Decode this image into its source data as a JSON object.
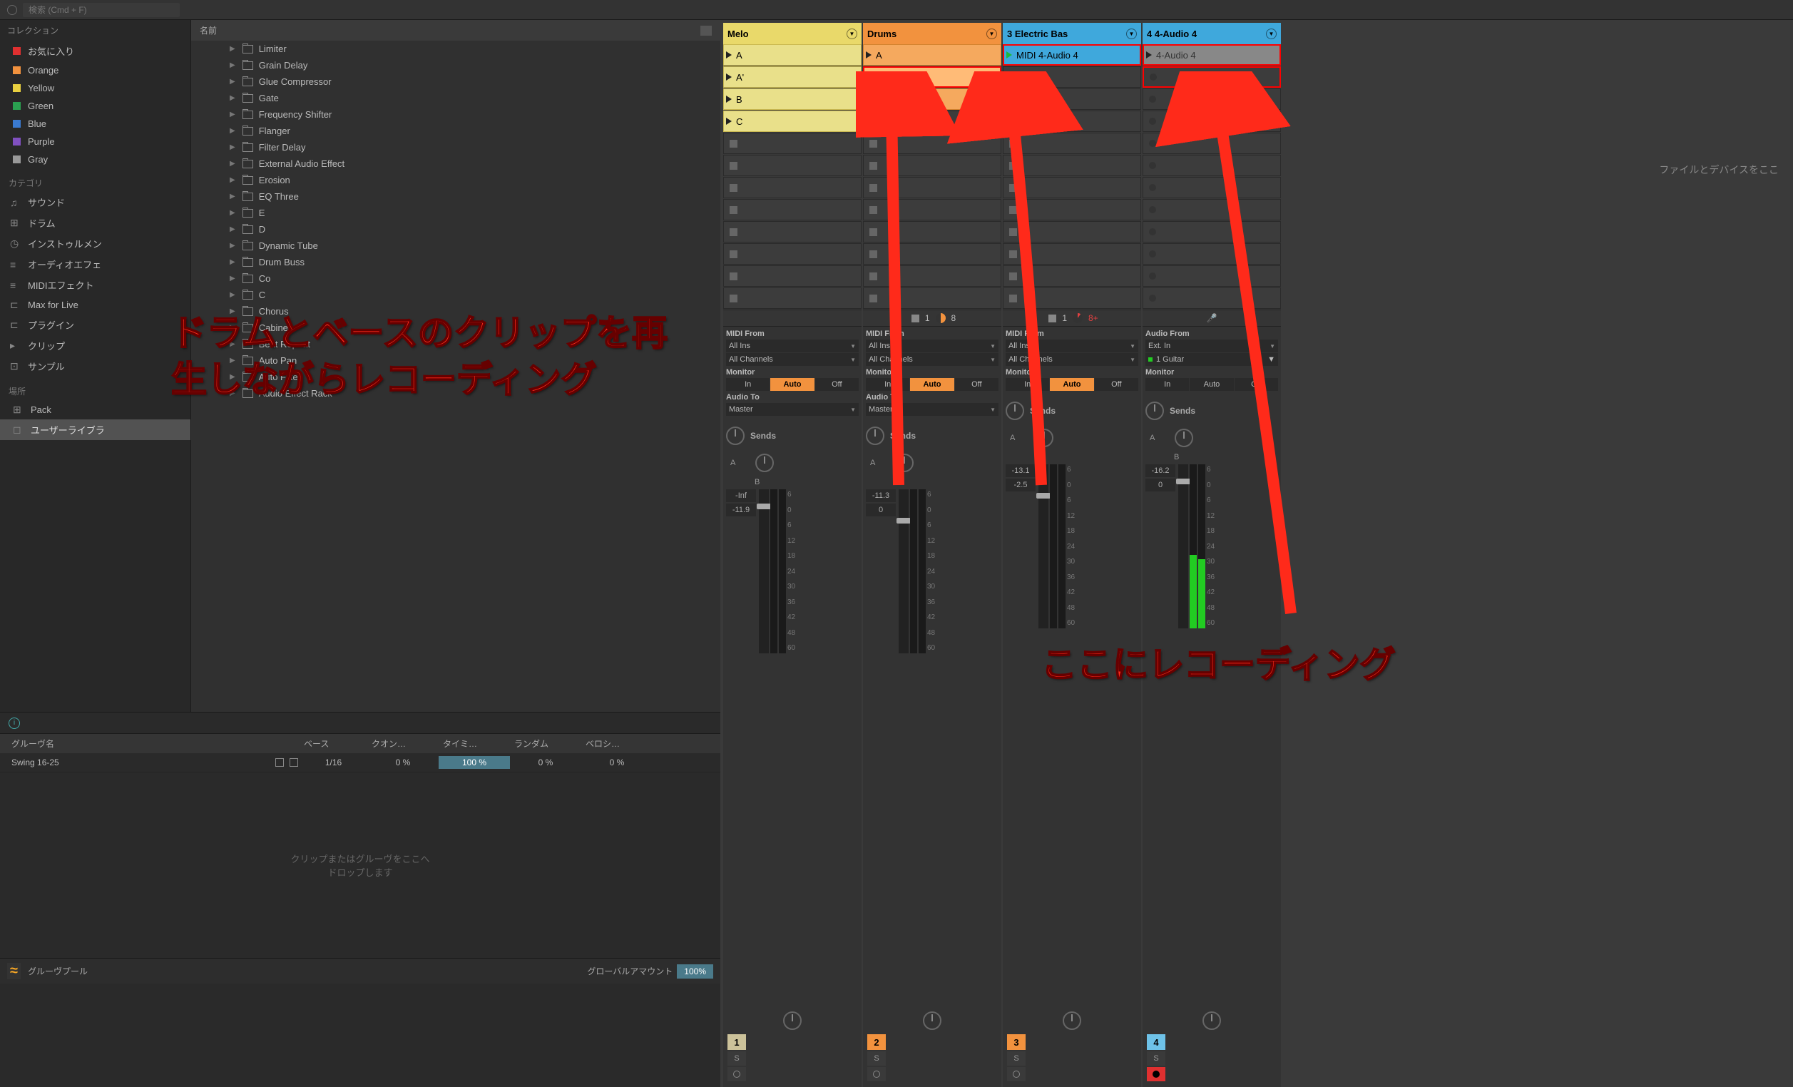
{
  "search": {
    "placeholder": "検索 (Cmd + F)"
  },
  "collections": {
    "header": "コレクション",
    "items": [
      {
        "label": "お気に入り",
        "color": "#e03030"
      },
      {
        "label": "Orange",
        "color": "#f2923e"
      },
      {
        "label": "Yellow",
        "color": "#e9d040"
      },
      {
        "label": "Green",
        "color": "#2aa050"
      },
      {
        "label": "Blue",
        "color": "#3a7ad0"
      },
      {
        "label": "Purple",
        "color": "#8050c0"
      },
      {
        "label": "Gray",
        "color": "#999"
      }
    ]
  },
  "categories": {
    "header": "カテゴリ",
    "items": [
      "サウンド",
      "ドラム",
      "インストゥルメン",
      "オーディオエフェ",
      "MIDIエフェクト",
      "Max for Live",
      "プラグイン",
      "クリップ",
      "サンプル"
    ]
  },
  "places": {
    "header": "場所",
    "items": [
      "Pack",
      "ユーザーライブラ"
    ]
  },
  "tree": {
    "header": "名前",
    "items": [
      "Limiter",
      "Grain Delay",
      "Glue Compressor",
      "Gate",
      "Frequency Shifter",
      "Flanger",
      "Filter Delay",
      "External Audio Effect",
      "Erosion",
      "EQ Three",
      "E",
      "D",
      "Dynamic Tube",
      "Drum Buss",
      "Co",
      "C",
      "Chorus",
      "Cabinet",
      "Beat Repeat",
      "Auto Pan",
      "Auto Filter",
      "Audio Effect Rack"
    ]
  },
  "groove": {
    "header": "グルーヴ名",
    "cols": [
      "ベース",
      "クオン…",
      "タイミ…",
      "ランダム",
      "ベロシ…"
    ],
    "row": {
      "name": "Swing 16-25",
      "base": "1/16",
      "quant": "0 %",
      "timing": "100 %",
      "random": "0 %",
      "velocity": "0 %"
    },
    "drop_hint": "クリップまたはグルーヴをここへ\nドロップします",
    "footer_label": "グルーヴプール",
    "global_label": "グローバルアマウント",
    "global_value": "100%"
  },
  "tracks": [
    {
      "name": "Melo",
      "class": "melo",
      "clips": [
        "A",
        "A'",
        "B",
        "C"
      ],
      "status": {
        "show": false
      },
      "io": {
        "from": "MIDI From",
        "ins": "All Ins",
        "ch": "All Channels",
        "monitor": "Auto",
        "to": "Audio To",
        "out": "Master"
      },
      "vol": [
        "-Inf",
        "-11.9"
      ],
      "num": "1",
      "num_class": "c1"
    },
    {
      "name": "Drums",
      "class": "drums",
      "clips": [
        "A",
        "A",
        "B"
      ],
      "status": {
        "show": true,
        "a": "1",
        "b": "8"
      },
      "io": {
        "from": "MIDI From",
        "ins": "All Ins",
        "ch": "All Channels",
        "monitor": "Auto",
        "to": "Audio To",
        "out": "Master"
      },
      "vol": [
        "-11.3",
        "0"
      ],
      "num": "2",
      "num_class": "c2"
    },
    {
      "name": "3 Electric Bas",
      "class": "bass",
      "clips": [
        "MIDI 4-Audio 4"
      ],
      "status": {
        "show": true,
        "a": "1",
        "b": "8+",
        "red": true
      },
      "io": {
        "from": "MIDI From",
        "ins": "All Ins",
        "ch": "All Channels",
        "monitor": "Auto",
        "to": "",
        "out": ""
      },
      "vol": [
        "-13.1",
        "-2.5"
      ],
      "num": "3",
      "num_class": "c3"
    },
    {
      "name": "4 4-Audio 4",
      "class": "audio4",
      "clips": [
        "4-Audio 4"
      ],
      "status": {
        "show": true,
        "mic": true
      },
      "io": {
        "from": "Audio From",
        "ins": "Ext. In",
        "ch": "1 Guitar",
        "monitor": "",
        "to": "",
        "out": ""
      },
      "vol": [
        "-16.2",
        "0"
      ],
      "num": "4",
      "num_class": "c4",
      "armed": true
    }
  ],
  "io_labels": {
    "monitor": "Monitor",
    "in": "In",
    "auto": "Auto",
    "off": "Off",
    "sends": "Sends",
    "a": "A",
    "b": "B",
    "solo": "S"
  },
  "scale": [
    "6",
    "0",
    "6",
    "12",
    "18",
    "24",
    "30",
    "36",
    "42",
    "48",
    "60"
  ],
  "right_hint": "ファイルとデバイスをここ",
  "annotations": {
    "main": "ドラムとベースのクリップを再\n生しながらレコーディング",
    "sub": "ここにレコーディング"
  }
}
